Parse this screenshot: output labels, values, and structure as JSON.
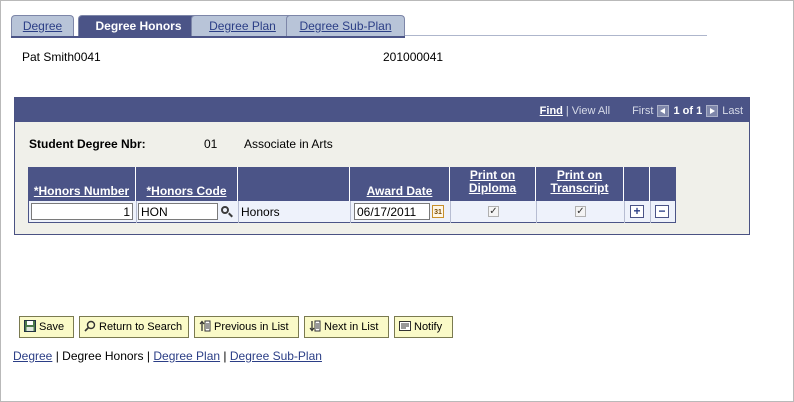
{
  "tabs": [
    {
      "label": "Degree",
      "active": false
    },
    {
      "label": "Degree Honors",
      "active": true
    },
    {
      "label": "Degree Plan",
      "active": false
    },
    {
      "label": "Degree Sub-Plan",
      "active": false
    }
  ],
  "student": {
    "name": "Pat Smith0041",
    "id": "201000041"
  },
  "scroll_nav": {
    "find": "Find",
    "view_all": "View All",
    "first": "First",
    "count": "1 of 1",
    "last": "Last"
  },
  "degree": {
    "label": "Student Degree Nbr:",
    "number": "01",
    "description": "Associate in Arts"
  },
  "grid": {
    "headers": {
      "honors_number": "*Honors Number",
      "honors_code": "*Honors Code",
      "award_date": "Award Date",
      "print_diploma_1": "Print on",
      "print_diploma_2": "Diploma",
      "print_transcript_1": "Print on",
      "print_transcript_2": "Transcript"
    },
    "row": {
      "honors_number": "1",
      "honors_code": "HON",
      "honors_desc": "Honors",
      "award_date": "06/17/2011",
      "print_diploma": true,
      "print_transcript": true
    },
    "add": "+",
    "delete": "−"
  },
  "toolbar": {
    "save": "Save",
    "return_to_search": "Return to Search",
    "previous_in_list": "Previous in List",
    "next_in_list": "Next in List",
    "notify": "Notify"
  },
  "footer_links": {
    "degree": "Degree",
    "degree_honors": "Degree Honors",
    "degree_plan": "Degree Plan",
    "degree_sub_plan": "Degree Sub-Plan",
    "sep": "|"
  },
  "colors": {
    "header_bar": "#4b5487",
    "tab_inactive": "#b8c4d8",
    "button_bg": "#fafac8",
    "panel_bg": "#f0f0ea"
  }
}
